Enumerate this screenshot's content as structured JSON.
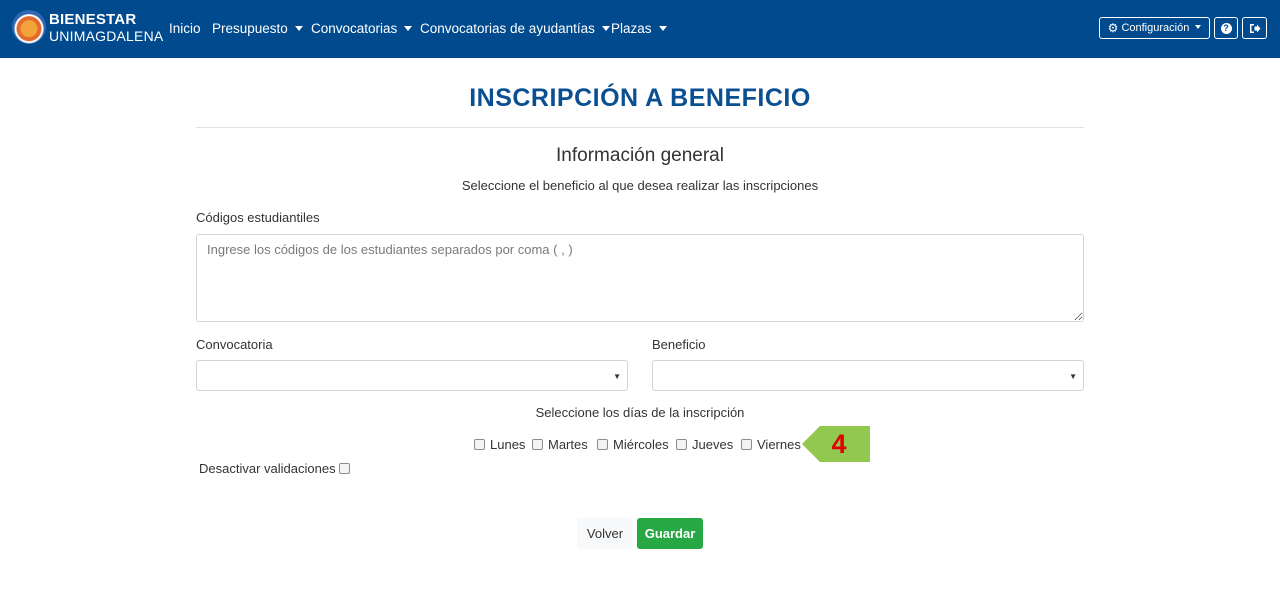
{
  "navbar": {
    "brand_top": "BIENESTAR",
    "brand_bottom": "UNIMAGDALENA",
    "items": [
      {
        "label": "Inicio"
      },
      {
        "label": "Presupuesto"
      },
      {
        "label": "Convocatorias"
      },
      {
        "label": "Convocatorias de ayudantías"
      },
      {
        "label": "Plazas"
      }
    ],
    "config_label": "Configuración",
    "help_icon": "question-circle-icon",
    "logout_icon": "sign-out-icon"
  },
  "page": {
    "title": "INSCRIPCIÓN A BENEFICIO",
    "section_title": "Información general",
    "subtitle": "Seleccione el beneficio al que desea realizar las inscripciones"
  },
  "form": {
    "codes_label": "Códigos estudiantiles",
    "codes_placeholder": "Ingrese los códigos de los estudiantes separados por coma ( , )",
    "convocatoria_label": "Convocatoria",
    "beneficio_label": "Beneficio",
    "days_title": "Seleccione los días de la inscripción",
    "days": [
      {
        "label": "Lunes",
        "checked": false
      },
      {
        "label": "Martes",
        "checked": false
      },
      {
        "label": "Miércoles",
        "checked": false
      },
      {
        "label": "Jueves",
        "checked": false
      },
      {
        "label": "Viernes",
        "checked": false
      }
    ],
    "disable_validations_label": "Desactivar validaciones",
    "disable_validations_checked": false,
    "back_label": "Volver",
    "save_label": "Guardar"
  },
  "annotation": {
    "step_number": "4",
    "color": "#93c850"
  },
  "colors": {
    "navbar": "#004a8d",
    "title": "#0b4f93",
    "save_button": "#28a745"
  }
}
